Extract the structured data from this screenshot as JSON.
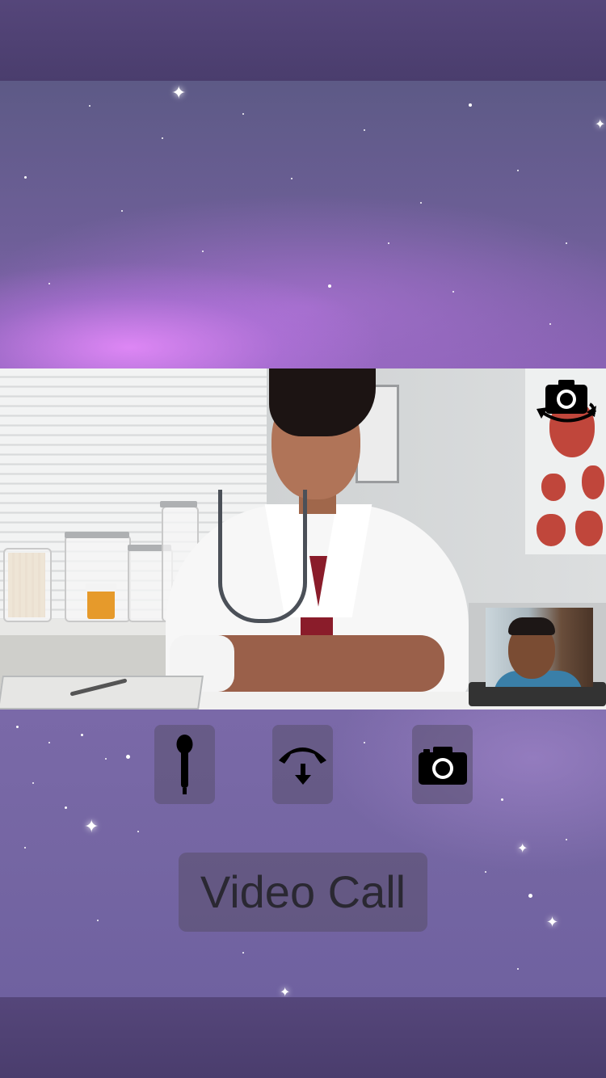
{
  "call": {
    "title_button_label": "Video Call"
  },
  "controls": {
    "mute_icon": "microphone-icon",
    "end_call_icon": "hang-up-icon",
    "camera_icon": "camera-icon",
    "switch_camera_icon": "switch-camera-icon"
  },
  "colors": {
    "background_dark": "#4a3d6b",
    "space_purple": "#7a69a8",
    "button_fill": "#5a506e",
    "icon": "#000000"
  }
}
